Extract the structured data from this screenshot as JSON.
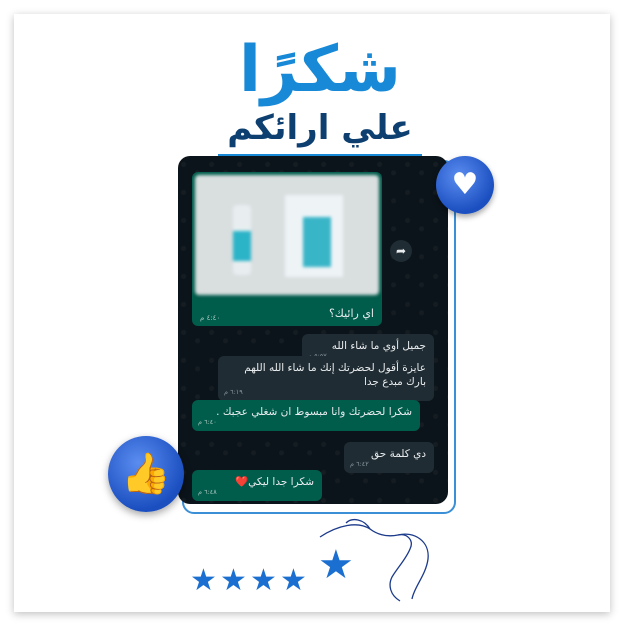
{
  "header": {
    "title": "شكرًا",
    "subtitle": "علي ارائكم"
  },
  "chat": {
    "image_message": {
      "caption": "اي رائيك؟",
      "time": "٤:٤٠ م"
    },
    "messages": [
      {
        "direction": "in",
        "text": "جميل أوي ما شاء الله",
        "time": "٥:٥٧ م"
      },
      {
        "direction": "in",
        "text": "عايزة أقول لحضرتك إنك ما شاء الله اللهم بارك مبدع جدا",
        "time": "٦:١٩ م"
      },
      {
        "direction": "out",
        "text": "شكرا لحضرتك وانا مبسوط ان شغلي عجبك .",
        "time": "٦:٤٠ م"
      },
      {
        "direction": "in",
        "text": "دي كلمة حق",
        "time": "٦:٤٢ م"
      },
      {
        "direction": "out",
        "text": "شكرا جدا ليكي❤️",
        "time": "٦:٤٨ م"
      }
    ]
  },
  "icons": {
    "heart": "heart-icon",
    "like": "thumbs-up-icon",
    "forward": "forward-icon",
    "star": "star-icon"
  },
  "rating": {
    "stars": 5,
    "max": 5
  },
  "colors": {
    "accent": "#1789d6",
    "dark_blue": "#0d3f70",
    "chat_bg": "#0b141a",
    "incoming": "#202c33",
    "outgoing": "#005c4b"
  }
}
